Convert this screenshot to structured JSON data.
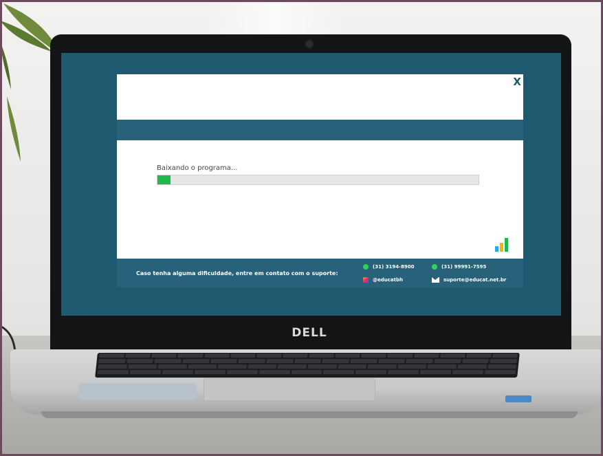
{
  "dialog": {
    "close_label": "X",
    "progress": {
      "label": "Baixando o programa...",
      "percent": 4,
      "fill_color": "#1fb84a"
    },
    "footer": {
      "message": "Caso tenha alguma dificuldade, entre em contato com o suporte:",
      "contacts": {
        "whatsapp_1": "(31) 3194-8900",
        "whatsapp_2": "(31) 99991-7595",
        "instagram": "@educatbh",
        "email": "suporte@educat.net.br"
      }
    }
  },
  "laptop": {
    "brand": "DELL"
  },
  "colors": {
    "screen": "#1d5a6f",
    "band": "#27627a"
  },
  "icons": [
    "close-icon",
    "whatsapp-icon",
    "instagram-icon",
    "email-icon",
    "bar-chart-logo-icon"
  ]
}
